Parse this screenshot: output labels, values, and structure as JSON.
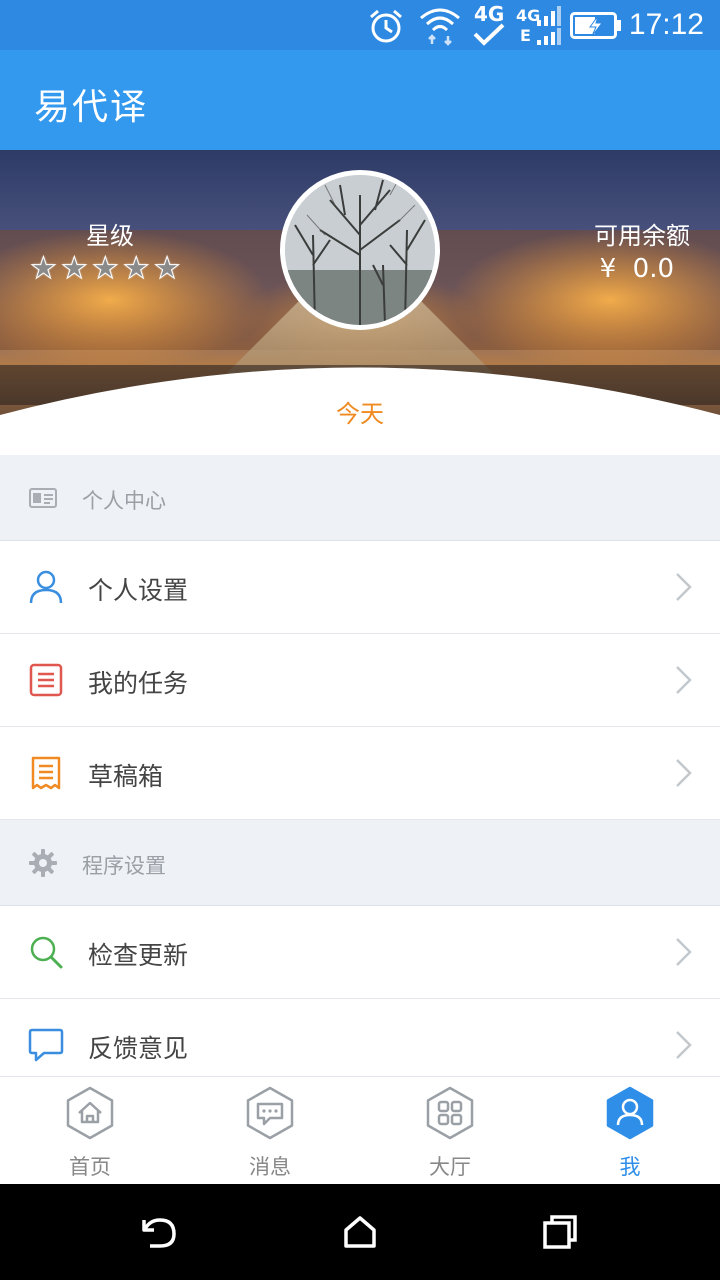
{
  "status_bar": {
    "network_label": "4G",
    "network_label_2": "4G",
    "network_label_3": "E",
    "time": "17:12",
    "icons": [
      "alarm-icon",
      "wifi-icon",
      "signal-icon",
      "battery-charging-icon"
    ]
  },
  "app_bar": {
    "title": "易代译"
  },
  "profile": {
    "rating_label": "星级",
    "rating": 5,
    "rating_max": 5,
    "stars": [
      "★",
      "★",
      "★",
      "★",
      "★"
    ],
    "balance_label": "可用余额",
    "balance_value": "¥  0.0",
    "today_label": "今天"
  },
  "sections": [
    {
      "label": "个人中心",
      "icon": "id-card-icon",
      "items": [
        {
          "label": "个人设置",
          "icon": "user-icon",
          "color": "#3A8EE0"
        },
        {
          "label": "我的任务",
          "icon": "task-list-icon",
          "color": "#E0574F"
        },
        {
          "label": "草稿箱",
          "icon": "draft-receipt-icon",
          "color": "#F08A22"
        }
      ]
    },
    {
      "label": "程序设置",
      "icon": "gear-icon",
      "items": [
        {
          "label": "检查更新",
          "icon": "search-icon",
          "color": "#4CB050"
        },
        {
          "label": "反馈意见",
          "icon": "chat-bubble-icon",
          "color": "#3A8EE0"
        }
      ]
    }
  ],
  "bottom_nav": {
    "tabs": [
      {
        "label": "首页",
        "icon": "home-icon",
        "active": false
      },
      {
        "label": "消息",
        "icon": "message-icon",
        "active": false
      },
      {
        "label": "大厅",
        "icon": "grid-icon",
        "active": false
      },
      {
        "label": "我",
        "icon": "profile-icon",
        "active": true
      }
    ]
  },
  "colors": {
    "status_bar": "#2E89E2",
    "app_bar": "#3399EE",
    "accent": "#2E8EE8",
    "today": "#F08A22",
    "section_bg": "#EEF1F5"
  }
}
